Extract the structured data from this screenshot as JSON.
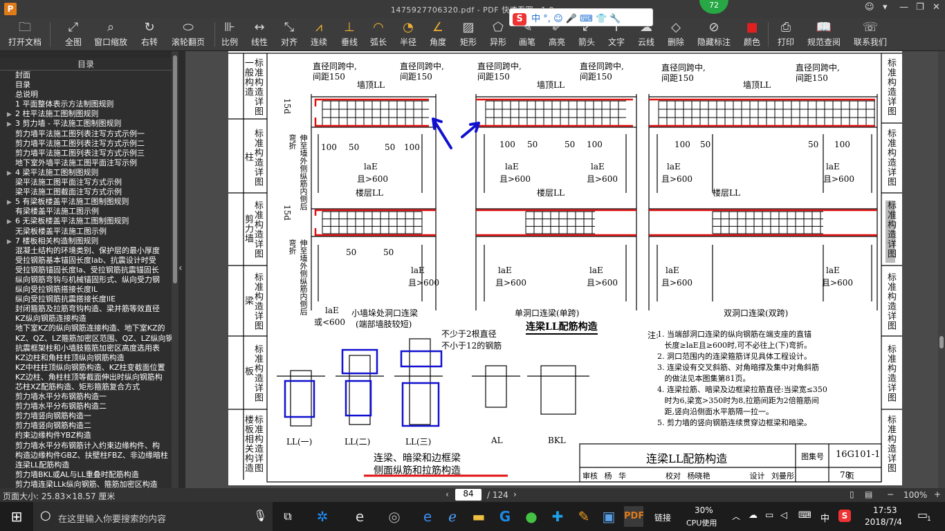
{
  "window": {
    "title": "1475927706320.pdf - PDF 快速看图 v1.9",
    "badge": "72"
  },
  "ime": {
    "label": "中",
    "punct": "°,"
  },
  "toolbar": {
    "items": [
      {
        "label": "打开文档",
        "icon": "folder-icon",
        "g": "🗀"
      },
      {
        "label": "全图",
        "icon": "fullscreen-icon",
        "g": "⤢"
      },
      {
        "label": "窗口缩放",
        "icon": "zoom-window-icon",
        "g": "⌕"
      },
      {
        "label": "右转",
        "icon": "rotate-right-icon",
        "g": "↻"
      },
      {
        "label": "滚轮翻页",
        "icon": "mouse-icon",
        "g": "⬭"
      },
      {
        "label": "比例",
        "icon": "scale-ruler-icon",
        "g": "⊪"
      },
      {
        "label": "线性",
        "icon": "linear-dimension-icon",
        "g": "↔"
      },
      {
        "label": "对齐",
        "icon": "aligned-dimension-icon",
        "g": "⤡"
      },
      {
        "label": "连续",
        "icon": "continuous-dimension-icon",
        "g": "⩘"
      },
      {
        "label": "垂线",
        "icon": "perpendicular-icon",
        "g": "⊥"
      },
      {
        "label": "弧长",
        "icon": "arc-length-icon",
        "g": "◠"
      },
      {
        "label": "半径",
        "icon": "radius-icon",
        "g": "◔"
      },
      {
        "label": "角度",
        "icon": "angle-icon",
        "g": "∠"
      },
      {
        "label": "矩形",
        "icon": "rectangle-area-icon",
        "g": "▨"
      },
      {
        "label": "异形",
        "icon": "polygon-area-icon",
        "g": "⬠"
      },
      {
        "label": "画笔",
        "icon": "pen-icon",
        "g": "✎"
      },
      {
        "label": "高亮",
        "icon": "highlight-icon",
        "g": "✐"
      },
      {
        "label": "箭头",
        "icon": "arrow-icon",
        "g": "↙"
      },
      {
        "label": "文字",
        "icon": "text-icon",
        "g": "T"
      },
      {
        "label": "云线",
        "icon": "cloud-line-icon",
        "g": "☁"
      },
      {
        "label": "删除",
        "icon": "eraser-icon",
        "g": "◇"
      },
      {
        "label": "隐藏标注",
        "icon": "hide-markup-icon",
        "g": "⊘"
      },
      {
        "label": "颜色",
        "icon": "color-swatch-icon",
        "g": "■"
      },
      {
        "label": "打印",
        "icon": "printer-icon",
        "g": "⎙"
      },
      {
        "label": "规范查阅",
        "icon": "book-icon",
        "g": "📖"
      },
      {
        "label": "联系我们",
        "icon": "contact-icon",
        "g": "☏"
      }
    ]
  },
  "sidebar": {
    "title": "目录",
    "items": [
      {
        "t": "封面",
        "a": ""
      },
      {
        "t": "目录",
        "a": ""
      },
      {
        "t": "总说明",
        "a": ""
      },
      {
        "t": "1 平面整体表示方法制图规则",
        "a": ""
      },
      {
        "t": "2 柱平法施工图制图规则",
        "a": "▶"
      },
      {
        "t": "3 剪力墙 - 平法施工图制图规则",
        "a": "▶"
      },
      {
        "t": "剪力墙平法施工图列表注写方式示例一",
        "a": ""
      },
      {
        "t": "剪力墙平法施工图列表注写方式示例二",
        "a": ""
      },
      {
        "t": "剪力墙平法施工图列表注写方式示例三",
        "a": ""
      },
      {
        "t": "地下室外墙平法施工图平面注写示例",
        "a": ""
      },
      {
        "t": "4 梁平法施工图制图规则",
        "a": "▶"
      },
      {
        "t": "梁平法施工图平面注写方式示例",
        "a": ""
      },
      {
        "t": "梁平法施工图截面注写方式示例",
        "a": ""
      },
      {
        "t": "5 有梁板楼盖平法施工图制图规则",
        "a": "▶"
      },
      {
        "t": "有梁楼盖平法施工图示例",
        "a": ""
      },
      {
        "t": "6 无梁板楼盖平法施工图制图规则",
        "a": "▶"
      },
      {
        "t": "无梁板楼盖平法施工图示例",
        "a": ""
      },
      {
        "t": "7 楼板相关构造制图规则",
        "a": "▶"
      },
      {
        "t": "混凝土结构的环境类别、保护层的最小厚度",
        "a": ""
      },
      {
        "t": "受拉钢筋基本锚固长度lab、抗震设计时受",
        "a": ""
      },
      {
        "t": "受拉钢筋锚固长度la、受拉钢筋抗震锚固长",
        "a": ""
      },
      {
        "t": "纵向钢筋弯钩与机械锚固形式、纵向受力钢",
        "a": ""
      },
      {
        "t": "纵向受拉钢筋搭接长度lL",
        "a": ""
      },
      {
        "t": "纵向受拉钢筋抗震搭接长度llE",
        "a": ""
      },
      {
        "t": "封闭箍筋及拉筋弯钩构造、梁并筋等效直径",
        "a": ""
      },
      {
        "t": "KZ纵向钢筋连接构造",
        "a": ""
      },
      {
        "t": "地下室KZ的纵向钢筋连接构造、地下室KZ的",
        "a": ""
      },
      {
        "t": "KZ、QZ、LZ箍筋加密区范围、QZ、LZ纵向钢",
        "a": ""
      },
      {
        "t": "抗震框架柱和小墙肢箍筋加密区高度选用表",
        "a": ""
      },
      {
        "t": "KZ边柱和角柱柱顶纵向钢筋构造",
        "a": ""
      },
      {
        "t": "KZ中柱柱顶纵向钢筋构造、KZ柱变截面位置",
        "a": ""
      },
      {
        "t": "KZ边柱、角柱柱顶等截面伸出时纵向钢筋构",
        "a": ""
      },
      {
        "t": "芯柱XZ配筋构造、矩形箍筋复合方式",
        "a": ""
      },
      {
        "t": "剪力墙水平分布钢筋构造一",
        "a": ""
      },
      {
        "t": "剪力墙水平分布钢筋构造二",
        "a": ""
      },
      {
        "t": "剪力墙竖向钢筋构造一",
        "a": ""
      },
      {
        "t": "剪力墙竖向钢筋构造二",
        "a": ""
      },
      {
        "t": "约束边缘构件YBZ构造",
        "a": ""
      },
      {
        "t": "剪力墙水平分布钢筋计入约束边缘构件、构",
        "a": ""
      },
      {
        "t": "构造边缘构件GBZ、扶壁柱FBZ、非边缘暗柱",
        "a": ""
      },
      {
        "t": "连梁LL配筋构造",
        "a": ""
      },
      {
        "t": "剪力墙BKL或AL与LL重叠时配筋构造",
        "a": ""
      },
      {
        "t": "剪力墙连梁LLk纵向钢筋、箍筋加密区构造",
        "a": ""
      }
    ]
  },
  "left_tabs": [
    "一般构造",
    "标准构造详图",
    "柱",
    "标准构造详图",
    "剪力墙",
    "标准构造详图",
    "梁",
    "标准构造详图",
    "板",
    "标准构造详图",
    "楼板相关构造",
    "标准构造详图"
  ],
  "right_tabs": [
    "标准构造详图",
    "标准构造详图",
    "标准构造详图",
    "标准构造详图",
    "标准构造详图",
    "标准构造详图"
  ],
  "drawing": {
    "spacing_note_a": "直径同跨中,",
    "spacing_note_b": "间距150",
    "wall_top_beam": "墙顶LL",
    "floor_beam": "楼层LL",
    "d15": "15d",
    "la": "laE",
    "gt600": "且>600",
    "n100": "100",
    "n50": "50",
    "vert_note": "伸至墙外侧纵筋内侧后弯折",
    "laE_or": "laE",
    "or600": "或<600",
    "cap1": "小墙垛处洞口连梁",
    "cap1b": "(端部墙肢较短)",
    "cap2": "单洞口连梁(单跨)",
    "cap3": "双洞口连梁(双跨)",
    "main_title": "连梁LL配筋构造",
    "note_dia_a": "不少于2根直径",
    "note_dia_b": "不小于12的钢筋",
    "sec_labels": [
      "LL(一)",
      "LL(二)",
      "LL(三)",
      "AL",
      "BKL"
    ],
    "sec_title_a": "连梁、暗梁和边框梁",
    "sec_title_b": "侧面纵筋和拉筋构造",
    "notes_head": "注:",
    "notes": [
      "1. 当端部洞口连梁的纵向钢筋在端支座的直锚",
      "   长度≥laE且≥600时,可不必往上(下)弯折。",
      "2. 洞口范围内的连梁箍筋详见具体工程设计。",
      "3. 连梁设有交叉斜筋、对角暗撑及集中对角斜筋",
      "   的做法见本图集第81页。",
      "4. 连梁拉筋、暗梁及边框梁拉筋直径:当梁宽≤350",
      "   时为6,梁宽>350时为8,拉筋间距为2倍箍筋间",
      "   距,竖向沿侧面水平筋隔一拉一。",
      "5. 剪力墙的竖向钢筋连续贯穿边框梁和暗梁。"
    ],
    "tb_title": "连梁LL配筋构造",
    "tb_atlas_label": "图集号",
    "tb_atlas": "16G101-1",
    "tb_row": [
      "审核",
      "杨 华",
      "校对",
      "杨晓艳",
      "设计",
      "刘曼彤",
      "页"
    ],
    "tb_page": "78"
  },
  "status": {
    "page_size": "页面大小: 25.83×18.57 厘米",
    "page": "84",
    "total": "/ 124",
    "zoom": "100%"
  },
  "taskbar": {
    "search_placeholder": "在这里输入你要搜索的内容",
    "link": "链接",
    "cpu_pct": "30%",
    "cpu_label": "CPU使用",
    "lang": "中",
    "time": "17:53",
    "date": "2018/7/4",
    "notif": "1"
  }
}
